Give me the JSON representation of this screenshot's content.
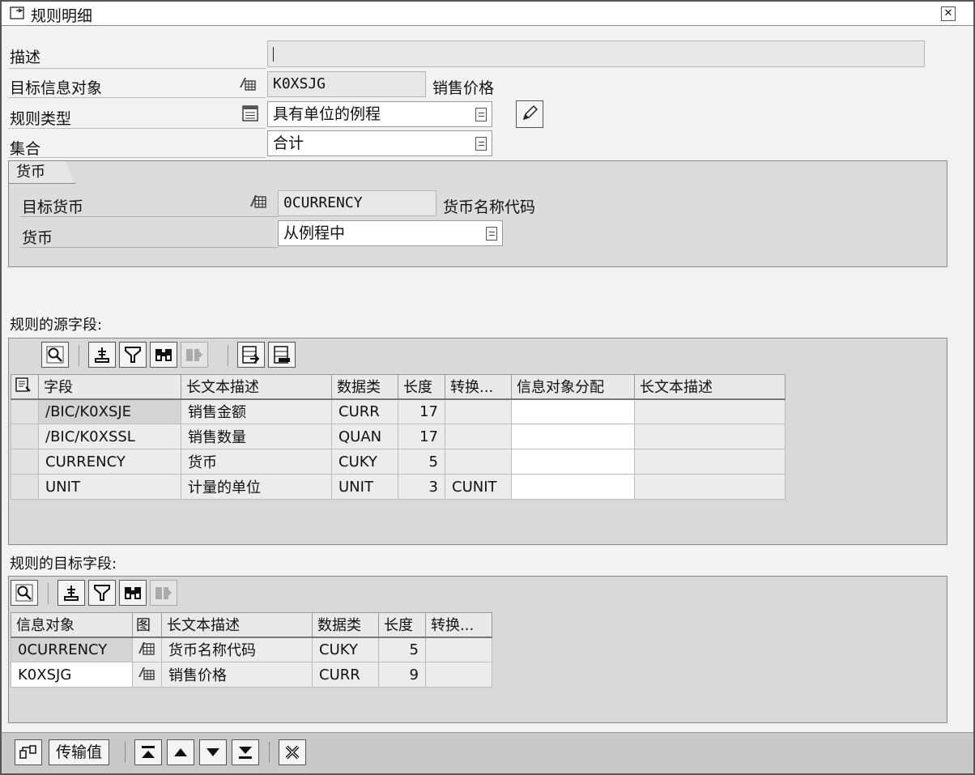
{
  "window": {
    "title": "规则明细"
  },
  "form": {
    "desc_label": "描述",
    "desc_value": "",
    "target_io_label": "目标信息对象",
    "target_io_value": "K0XSJG",
    "target_io_text": "销售价格",
    "rule_type_label": "规则类型",
    "rule_type_value": "具有单位的例程",
    "agg_label": "集合",
    "agg_value": "合计"
  },
  "currency_group": {
    "title": "货币",
    "target_currency_label": "目标货币",
    "target_currency_value": "0CURRENCY",
    "target_currency_text": "货币名称代码",
    "currency_label": "货币",
    "currency_value": "从例程中"
  },
  "source": {
    "title": "规则的源字段:",
    "columns": [
      "字段",
      "长文本描述",
      "数据类",
      "长度",
      "转换...",
      "信息对象分配",
      "长文本描述"
    ],
    "rows": [
      {
        "field": "/BIC/K0XSJE",
        "desc": "销售金额",
        "type": "CURR",
        "len": "17",
        "conv": "",
        "assign": "",
        "desc2": ""
      },
      {
        "field": "/BIC/K0XSSL",
        "desc": "销售数量",
        "type": "QUAN",
        "len": "17",
        "conv": "",
        "assign": "",
        "desc2": ""
      },
      {
        "field": "CURRENCY",
        "desc": "货币",
        "type": "CUKY",
        "len": "5",
        "conv": "",
        "assign": "",
        "desc2": ""
      },
      {
        "field": "UNIT",
        "desc": "计量的单位",
        "type": "UNIT",
        "len": "3",
        "conv": "CUNIT",
        "assign": "",
        "desc2": ""
      }
    ]
  },
  "target": {
    "title": "规则的目标字段:",
    "columns": [
      "信息对象",
      "图",
      "长文本描述",
      "数据类",
      "长度",
      "转换..."
    ],
    "rows": [
      {
        "io": "0CURRENCY",
        "desc": "货币名称代码",
        "type": "CUKY",
        "len": "5",
        "conv": ""
      },
      {
        "io": "K0XSJG",
        "desc": "销售价格",
        "type": "CURR",
        "len": "9",
        "conv": ""
      }
    ]
  },
  "bottom": {
    "transfer_label": "传输值"
  }
}
